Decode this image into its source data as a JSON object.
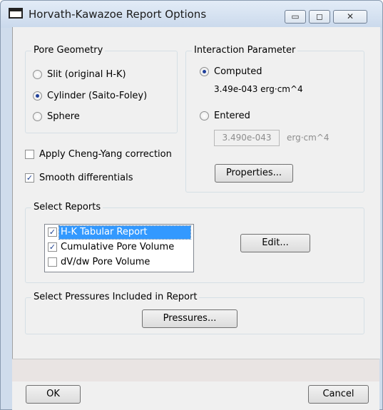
{
  "window": {
    "title": "Horvath-Kawazoe Report Options",
    "min_glyph": "▭",
    "max_glyph": "◻",
    "close_glyph": "✕"
  },
  "pore_geometry": {
    "legend": "Pore Geometry",
    "options": [
      {
        "label": "Slit (original H-K)",
        "selected": false
      },
      {
        "label": "Cylinder (Saito-Foley)",
        "selected": true
      },
      {
        "label": "Sphere",
        "selected": false
      }
    ]
  },
  "interaction": {
    "legend": "Interaction Parameter",
    "computed_label": "Computed",
    "computed_selected": true,
    "computed_value": "3.49e-043  erg·cm^4",
    "entered_label": "Entered",
    "entered_selected": false,
    "entered_value": "3.490e-043",
    "entered_units": "erg·cm^4",
    "properties_label": "Properties..."
  },
  "options": {
    "cheng_yang_label": "Apply Cheng-Yang correction",
    "cheng_yang_checked": false,
    "smooth_label": "Smooth differentials",
    "smooth_checked": true
  },
  "reports": {
    "legend": "Select Reports",
    "items": [
      {
        "label": "H-K Tabular Report",
        "checked": true,
        "selected": true
      },
      {
        "label": "Cumulative Pore Volume",
        "checked": true,
        "selected": false
      },
      {
        "label": "dV/dw Pore Volume",
        "checked": false,
        "selected": false
      }
    ],
    "edit_label": "Edit..."
  },
  "pressures": {
    "legend": "Select Pressures Included in Report",
    "button_label": "Pressures..."
  },
  "footer": {
    "ok_label": "OK",
    "cancel_label": "Cancel"
  },
  "check_glyph": "✓"
}
